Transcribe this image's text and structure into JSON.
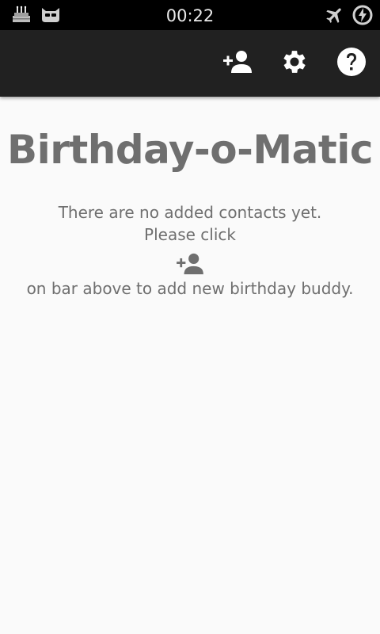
{
  "status_bar": {
    "time": "00:22",
    "left_icons": [
      "birthday-cake-icon",
      "cyanogen-mascot-icon"
    ],
    "right_icons": [
      "airplane-mode-icon",
      "battery-charging-icon"
    ]
  },
  "action_bar": {
    "actions": [
      {
        "name": "add-contact-button",
        "icon": "person-add-icon"
      },
      {
        "name": "settings-button",
        "icon": "gear-icon"
      },
      {
        "name": "help-button",
        "icon": "help-icon"
      }
    ],
    "background": "#212121"
  },
  "main": {
    "title": "Birthday-o-Matic",
    "line1": "There are no added contacts yet.",
    "line2": "Please click",
    "inline_icon": "person-add-icon",
    "line3": "on bar above to add new birthday buddy."
  },
  "colors": {
    "text": "#6f6f6f",
    "background": "#fafafa",
    "status_bar": "#000000"
  }
}
